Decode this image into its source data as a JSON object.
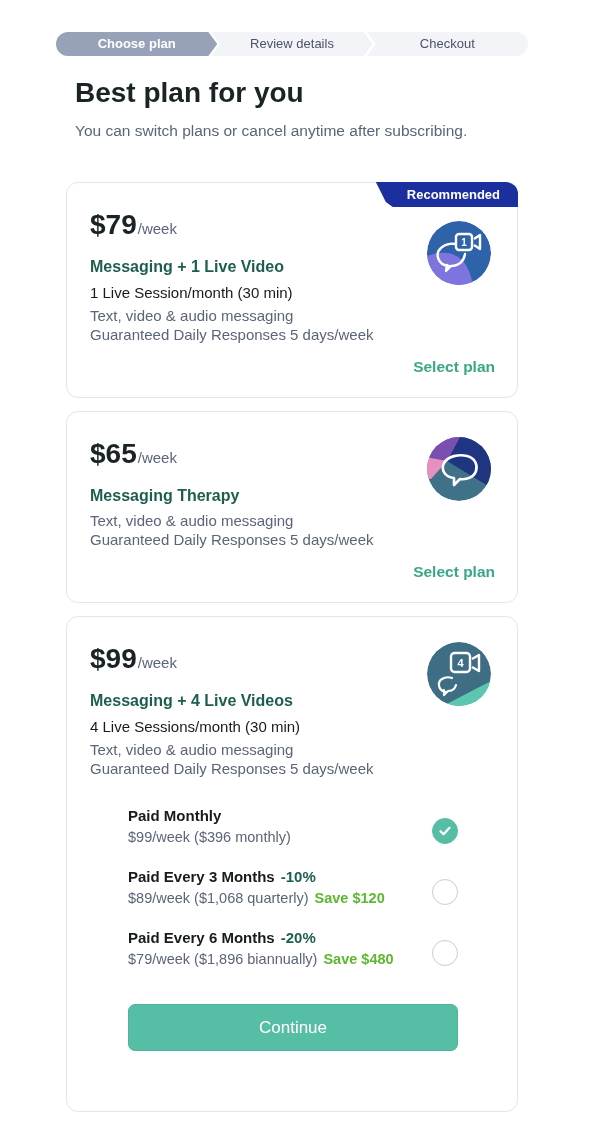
{
  "stepper": [
    {
      "label": "Choose plan",
      "selected": true
    },
    {
      "label": "Review details",
      "selected": false
    },
    {
      "label": "Checkout",
      "selected": false
    }
  ],
  "heading": "Best plan for you",
  "subheading": "You can switch plans or cancel anytime after subscribing.",
  "plans": [
    {
      "badge": "Recommended",
      "price": "$79",
      "period": "/week",
      "title": "Messaging + 1 Live Video",
      "sessions": "1 Live Session/month (30 min)",
      "features": [
        "Text, video & audio messaging",
        "Guaranteed Daily Responses 5 days/week"
      ],
      "icon": {
        "kind": "video",
        "count": "1"
      },
      "select_link": "Select plan"
    },
    {
      "price": "$65",
      "period": "/week",
      "title": "Messaging Therapy",
      "features": [
        "Text, video & audio messaging",
        "Guaranteed Daily Responses 5 days/week"
      ],
      "icon": {
        "kind": "chat"
      },
      "select_link": "Select plan"
    },
    {
      "price": "$99",
      "period": "/week",
      "title": "Messaging + 4 Live Videos",
      "sessions": "4 Live Sessions/month (30 min)",
      "features": [
        "Text, video & audio messaging",
        "Guaranteed Daily Responses 5 days/week"
      ],
      "icon": {
        "kind": "video",
        "count": "4"
      },
      "billing_options": [
        {
          "title": "Paid Monthly",
          "price": "$99/week ($396 monthly)",
          "selected": true
        },
        {
          "title": "Paid Every 3 Months",
          "discount": "-10%",
          "price": "$89/week ($1,068 quarterly)",
          "savings": "Save $120",
          "selected": false
        },
        {
          "title": "Paid Every 6 Months",
          "discount": "-20%",
          "price": "$79/week ($1,896 biannually)",
          "savings": "Save $480",
          "selected": false
        }
      ],
      "continue_button": "Continue"
    }
  ]
}
